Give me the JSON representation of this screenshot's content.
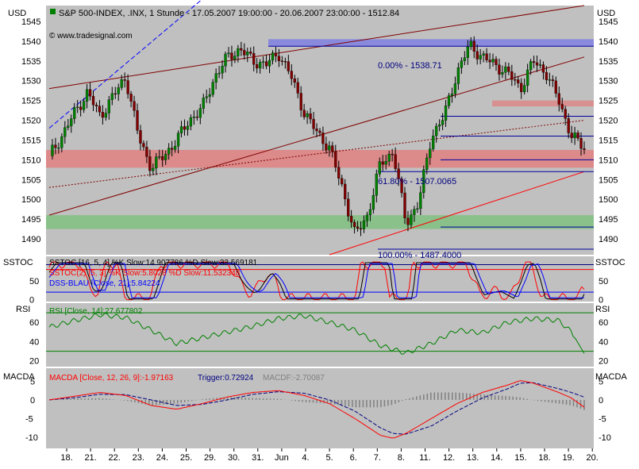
{
  "header": {
    "title": "S&P 500-INDEX, .INX, 1 Stunde - 17.05.2007 19:00:00 - 20.06.2007 23:00:00 - 1512.84",
    "copyright": "© www.tradesignal.com",
    "unit_left": "USD",
    "unit_right": "USD"
  },
  "colors": {
    "background": "#c0c0c0",
    "candle_up": "#008000",
    "candle_down": "#800000",
    "trend_channel": "#800000",
    "trend_blue": "#0000ff",
    "trend_red": "#ff0000",
    "zone_red": "#e08080",
    "zone_green": "#80c080",
    "zone_blue": "#8080e0",
    "rsi_line": "#008000",
    "macd_line": "#ff0000",
    "trigger_line": "#000080",
    "macdf_bars": "#808080"
  },
  "chart_data": [
    {
      "type": "candlestick",
      "panel": "price",
      "yticks": [
        1490,
        1495,
        1500,
        1505,
        1510,
        1515,
        1520,
        1525,
        1530,
        1535,
        1540,
        1545
      ],
      "ylim": [
        1486,
        1549
      ],
      "x_tick_labels": [
        "18.",
        "21.",
        "22.",
        "23.",
        "24.",
        "25.",
        "29.",
        "30.",
        "31.",
        "Jun",
        "4.",
        "5.",
        "6.",
        "7.",
        "8.",
        "11.",
        "12.",
        "13.",
        "14.",
        "15.",
        "18.",
        "19.",
        "20."
      ],
      "last_value": 1512.84,
      "close_path": [
        [
          0,
          1511
        ],
        [
          1,
          1516
        ],
        [
          2,
          1522
        ],
        [
          3,
          1527
        ],
        [
          4,
          1521
        ],
        [
          5,
          1526
        ],
        [
          6,
          1531
        ],
        [
          7,
          1516
        ],
        [
          8,
          1508
        ],
        [
          9,
          1511
        ],
        [
          10,
          1515
        ],
        [
          11,
          1520
        ],
        [
          12,
          1523
        ],
        [
          13,
          1531
        ],
        [
          14,
          1536
        ],
        [
          15,
          1538
        ],
        [
          16,
          1535
        ],
        [
          17,
          1534
        ],
        [
          18,
          1537
        ],
        [
          19,
          1531
        ],
        [
          20,
          1522
        ],
        [
          21,
          1517
        ],
        [
          22,
          1513
        ],
        [
          23,
          1503
        ],
        [
          24,
          1491
        ],
        [
          25,
          1496
        ],
        [
          26,
          1509
        ],
        [
          27,
          1512
        ],
        [
          28,
          1494
        ],
        [
          29,
          1499
        ],
        [
          30,
          1516
        ],
        [
          31,
          1521
        ],
        [
          32,
          1532
        ],
        [
          33,
          1539
        ],
        [
          34,
          1536
        ],
        [
          35,
          1534
        ],
        [
          36,
          1532
        ],
        [
          37,
          1528
        ],
        [
          38,
          1535
        ],
        [
          39,
          1532
        ],
        [
          40,
          1525
        ],
        [
          41,
          1516
        ],
        [
          42,
          1513
        ]
      ],
      "fibonacci": [
        {
          "label": "0.00% - 1538.71",
          "value": 1538.71
        },
        {
          "label": "61.80% - 1507.0065",
          "value": 1507.0065
        },
        {
          "label": "100.00% - 1487.4000",
          "value": 1487.4
        }
      ],
      "extra_levels": [
        1521,
        1516,
        1510,
        1493
      ],
      "zones": [
        {
          "name": "red-support-zone",
          "from": 1508,
          "to": 1512.5,
          "color": "#e08080"
        },
        {
          "name": "green-support-zone",
          "from": 1492.5,
          "to": 1496,
          "color": "#80c080"
        },
        {
          "name": "blue-resistance-zone",
          "from": 1538.7,
          "to": 1540.5,
          "color": "#8080e0"
        },
        {
          "name": "red-resistance-zone",
          "from": 1523.5,
          "to": 1525,
          "color": "#e08080"
        }
      ]
    },
    {
      "type": "line",
      "panel": "SSTOC",
      "title": "SSTOC",
      "legend": [
        {
          "text": "SSTOC [16, 5, 4] %K Slow:14.907786 %D Slow:32.569181",
          "color": "#000000"
        },
        {
          "text": "SSTOC(2) [5, 3] %K Slow:5.8028 %D Slow:11.532348",
          "color": "#ff0000"
        },
        {
          "text": "DSS-BLAU [Close, 21]:5.84224",
          "color": "#0000ff"
        }
      ],
      "yticks": [
        0,
        50
      ],
      "ylim": [
        -5,
        115
      ],
      "levels": [
        80,
        20
      ]
    },
    {
      "type": "line",
      "panel": "RSI",
      "title": "RSI",
      "legend": [
        {
          "text": "RSI [Close, 14]:27.677802",
          "color": "#008000"
        }
      ],
      "yticks": [
        20,
        40,
        60
      ],
      "ylim": [
        14,
        80
      ],
      "levels": [
        70,
        30
      ],
      "series": [
        {
          "values": [
            [
              0,
              55
            ],
            [
              2,
              62
            ],
            [
              4,
              68
            ],
            [
              6,
              65
            ],
            [
              8,
              52
            ],
            [
              10,
              38
            ],
            [
              12,
              44
            ],
            [
              14,
              50
            ],
            [
              16,
              56
            ],
            [
              18,
              64
            ],
            [
              20,
              67
            ],
            [
              22,
              60
            ],
            [
              24,
              52
            ],
            [
              26,
              36
            ],
            [
              28,
              28
            ],
            [
              30,
              38
            ],
            [
              32,
              52
            ],
            [
              34,
              49
            ],
            [
              36,
              60
            ],
            [
              38,
              64
            ],
            [
              40,
              62
            ],
            [
              41,
              50
            ],
            [
              42,
              27.7
            ]
          ]
        }
      ]
    },
    {
      "type": "line",
      "panel": "MACDA",
      "title": "MACDA",
      "legend": [
        {
          "text": "MACDA [Close, 12, 26, 9]:-1.97163",
          "color": "#ff0000"
        },
        {
          "text": "Trigger:0.72924",
          "color": "#000080"
        },
        {
          "text": "MACDF:-2.70087",
          "color": "#808080"
        }
      ],
      "yticks": [
        -10,
        -5,
        0,
        5
      ],
      "ylim": [
        -13,
        8.5
      ],
      "series": [
        {
          "name": "MACDA",
          "values": [
            [
              0,
              0
            ],
            [
              2,
              1
            ],
            [
              4,
              2
            ],
            [
              6,
              1.2
            ],
            [
              8,
              -1.5
            ],
            [
              10,
              -2.5
            ],
            [
              12,
              -1
            ],
            [
              14,
              0.8
            ],
            [
              16,
              2
            ],
            [
              18,
              2.5
            ],
            [
              20,
              1.2
            ],
            [
              22,
              -1
            ],
            [
              24,
              -5
            ],
            [
              26,
              -9.5
            ],
            [
              27,
              -10.3
            ],
            [
              28,
              -9
            ],
            [
              30,
              -5
            ],
            [
              32,
              -1
            ],
            [
              34,
              2
            ],
            [
              36,
              4
            ],
            [
              37,
              5.2
            ],
            [
              38,
              4.5
            ],
            [
              40,
              2
            ],
            [
              41,
              0.5
            ],
            [
              42,
              -1.97
            ]
          ]
        },
        {
          "name": "Trigger",
          "values": [
            [
              0,
              0
            ],
            [
              2,
              0.6
            ],
            [
              4,
              1.5
            ],
            [
              6,
              1.4
            ],
            [
              8,
              0
            ],
            [
              10,
              -1.5
            ],
            [
              12,
              -1.2
            ],
            [
              14,
              0
            ],
            [
              16,
              1.5
            ],
            [
              18,
              2.2
            ],
            [
              20,
              1.8
            ],
            [
              22,
              0
            ],
            [
              24,
              -3
            ],
            [
              26,
              -7.5
            ],
            [
              27,
              -9
            ],
            [
              28,
              -9.2
            ],
            [
              30,
              -7
            ],
            [
              32,
              -3
            ],
            [
              34,
              0.5
            ],
            [
              36,
              3
            ],
            [
              37,
              4.5
            ],
            [
              38,
              4.6
            ],
            [
              40,
              3
            ],
            [
              41,
              2
            ],
            [
              42,
              0.73
            ]
          ]
        }
      ]
    }
  ]
}
